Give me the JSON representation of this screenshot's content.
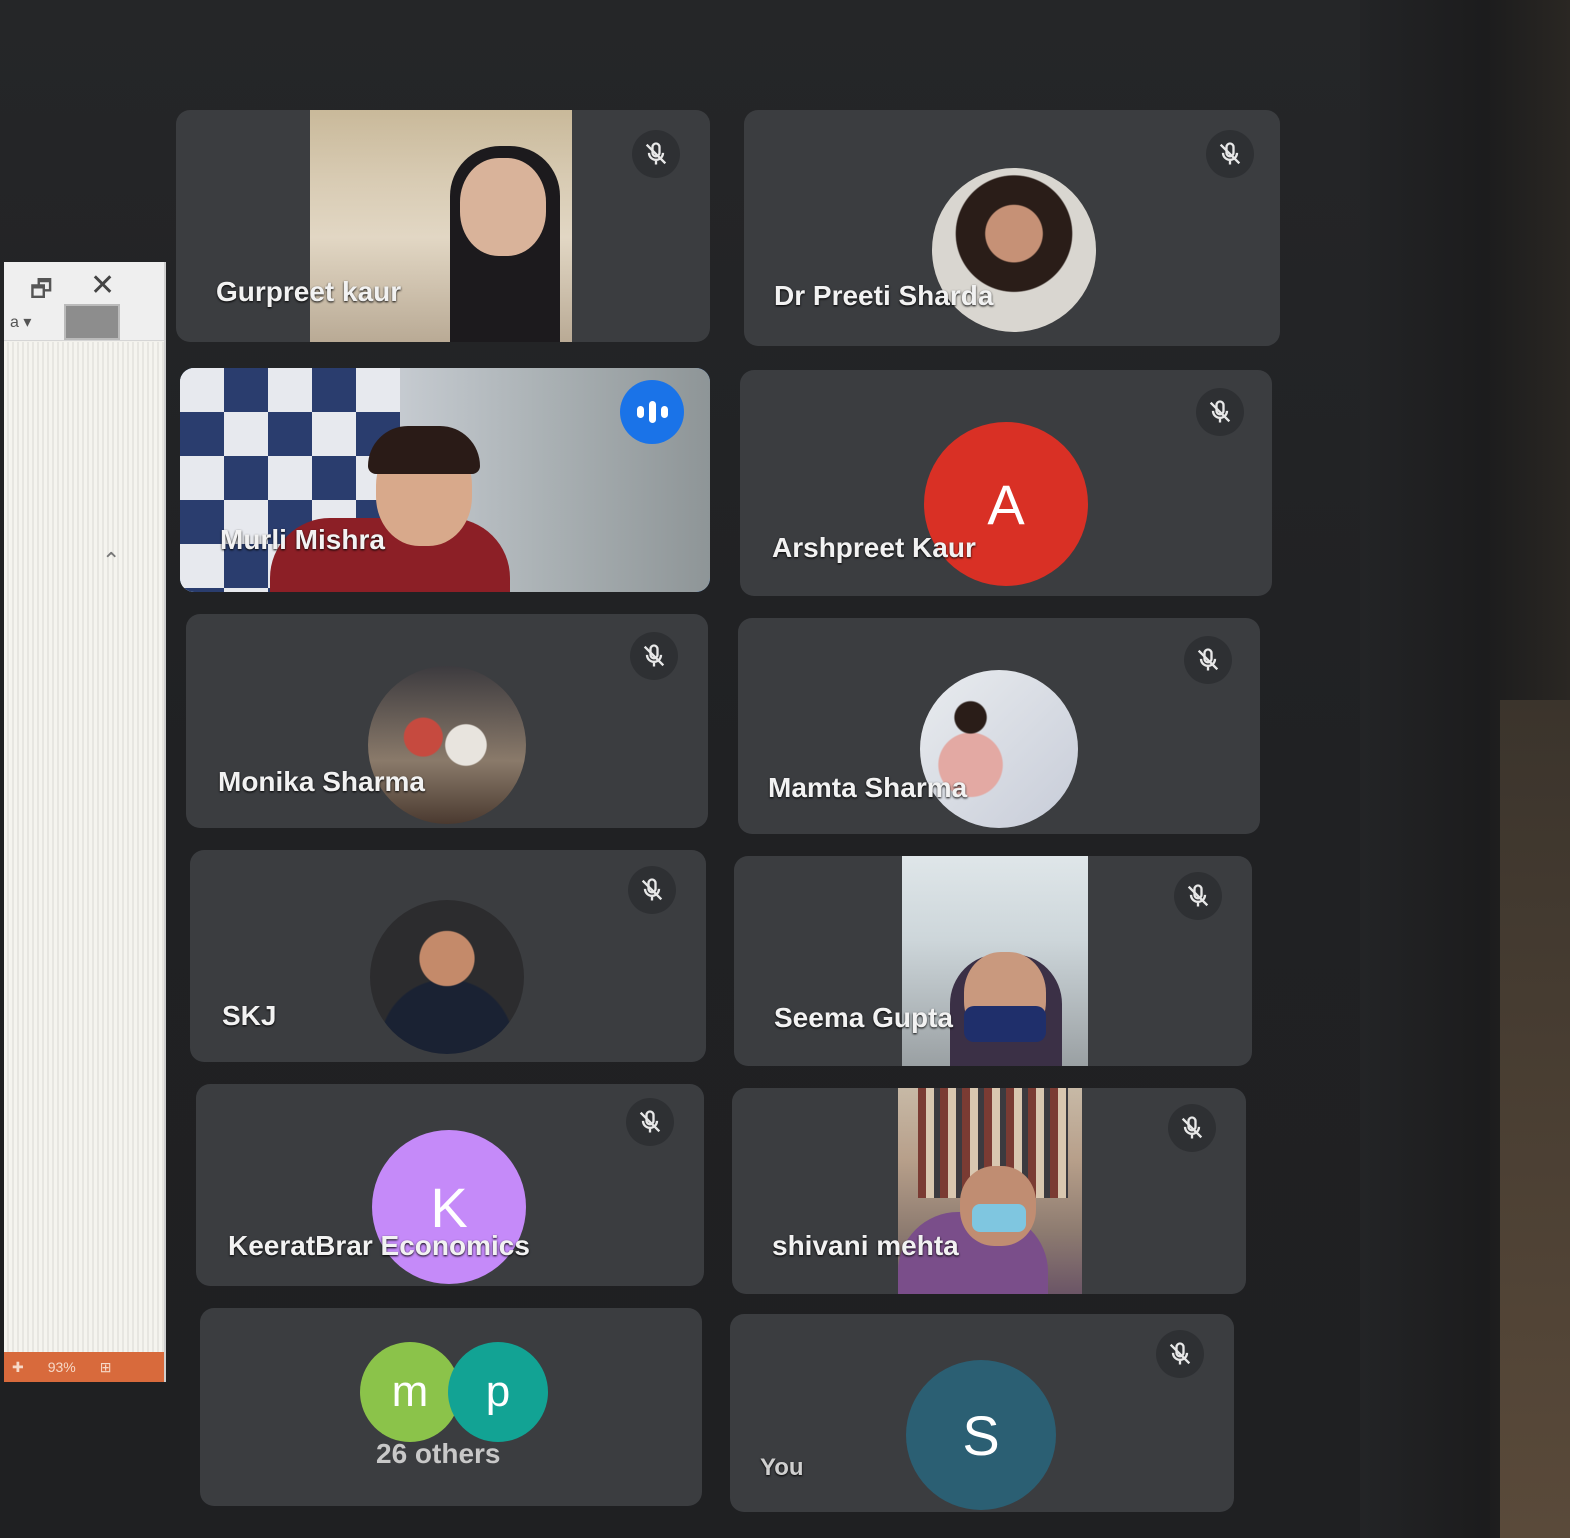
{
  "participants": [
    {
      "name": "Gurpreet kaur"
    },
    {
      "name": "Dr Preeti Sharda"
    },
    {
      "name": "Murli Mishra"
    },
    {
      "name": "Arshpreet Kaur",
      "initial": "A",
      "color": "#d93025"
    },
    {
      "name": "Monika Sharma"
    },
    {
      "name": "Mamta Sharma"
    },
    {
      "name": "SKJ"
    },
    {
      "name": "Seema Gupta"
    },
    {
      "name": "KeeratBrar Economics",
      "initial": "K",
      "color": "#c58af9"
    },
    {
      "name": "shivani mehta"
    },
    {
      "others_label": "26 others",
      "initials": [
        "m",
        "p"
      ],
      "colors": [
        "#8bc34a",
        "#12a394"
      ]
    },
    {
      "name": "You",
      "initial": "S",
      "color": "#2b5f73"
    }
  ],
  "background_app": {
    "zoom": "93%"
  },
  "colors": {
    "active_border": "#4a8fe7",
    "tile_bg": "#3b3d40"
  }
}
